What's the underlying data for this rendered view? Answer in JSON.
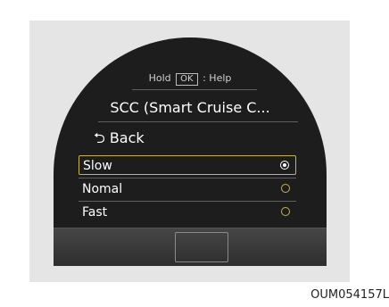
{
  "screen": {
    "hint_hold": "Hold",
    "hint_key": "OK",
    "hint_help": ": Help",
    "title": "SCC (Smart Cruise C...",
    "back_icon": "back-arrow-icon",
    "back_label": "Back",
    "options": [
      {
        "label": "Slow",
        "selected": true
      },
      {
        "label": "Nomal",
        "selected": false
      },
      {
        "label": "Fast",
        "selected": false
      }
    ]
  },
  "image_code": "OUM054157L",
  "colors": {
    "screen_bg": "#1d1d1d",
    "accent": "#c9b441",
    "text": "#ffffff"
  }
}
